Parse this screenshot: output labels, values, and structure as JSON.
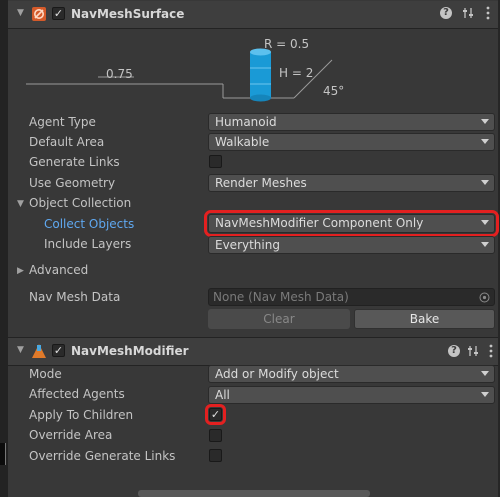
{
  "surface": {
    "title": "NavMeshSurface",
    "diagram": {
      "radius": "R = 0.5",
      "height": "H = 2",
      "step": "0.75",
      "slope": "45°"
    },
    "fields": [
      {
        "label": "Agent Type",
        "value": "Humanoid"
      },
      {
        "label": "Default Area",
        "value": "Walkable"
      },
      {
        "label": "Generate Links",
        "checked": false
      },
      {
        "label": "Use Geometry",
        "value": "Render Meshes"
      }
    ],
    "object_collection": {
      "label": "Object Collection",
      "collect_objects": {
        "label": "Collect Objects",
        "value": "NavMeshModifier Component Only"
      },
      "include_layers": {
        "label": "Include Layers",
        "value": "Everything"
      }
    },
    "advanced": "Advanced",
    "nav_mesh_data": {
      "label": "Nav Mesh Data",
      "value": "None (Nav Mesh Data)"
    },
    "clear_label": "Clear",
    "bake_label": "Bake"
  },
  "modifier": {
    "title": "NavMeshModifier",
    "mode": {
      "label": "Mode",
      "value": "Add or Modify object"
    },
    "affected_agents": {
      "label": "Affected Agents",
      "value": "All"
    },
    "apply_to_children": {
      "label": "Apply To Children",
      "checked": true
    },
    "override_area": {
      "label": "Override Area",
      "checked": false
    },
    "override_generate_links": {
      "label": "Override Generate Links",
      "checked": false
    }
  },
  "icons": {
    "help": "help-icon",
    "presets": "presets-icon",
    "menu": "kebab-menu-icon"
  },
  "colors": {
    "highlight": "#e32020",
    "agent_cylinder": "#1a9ad6",
    "active_label": "#5fa8f0"
  }
}
